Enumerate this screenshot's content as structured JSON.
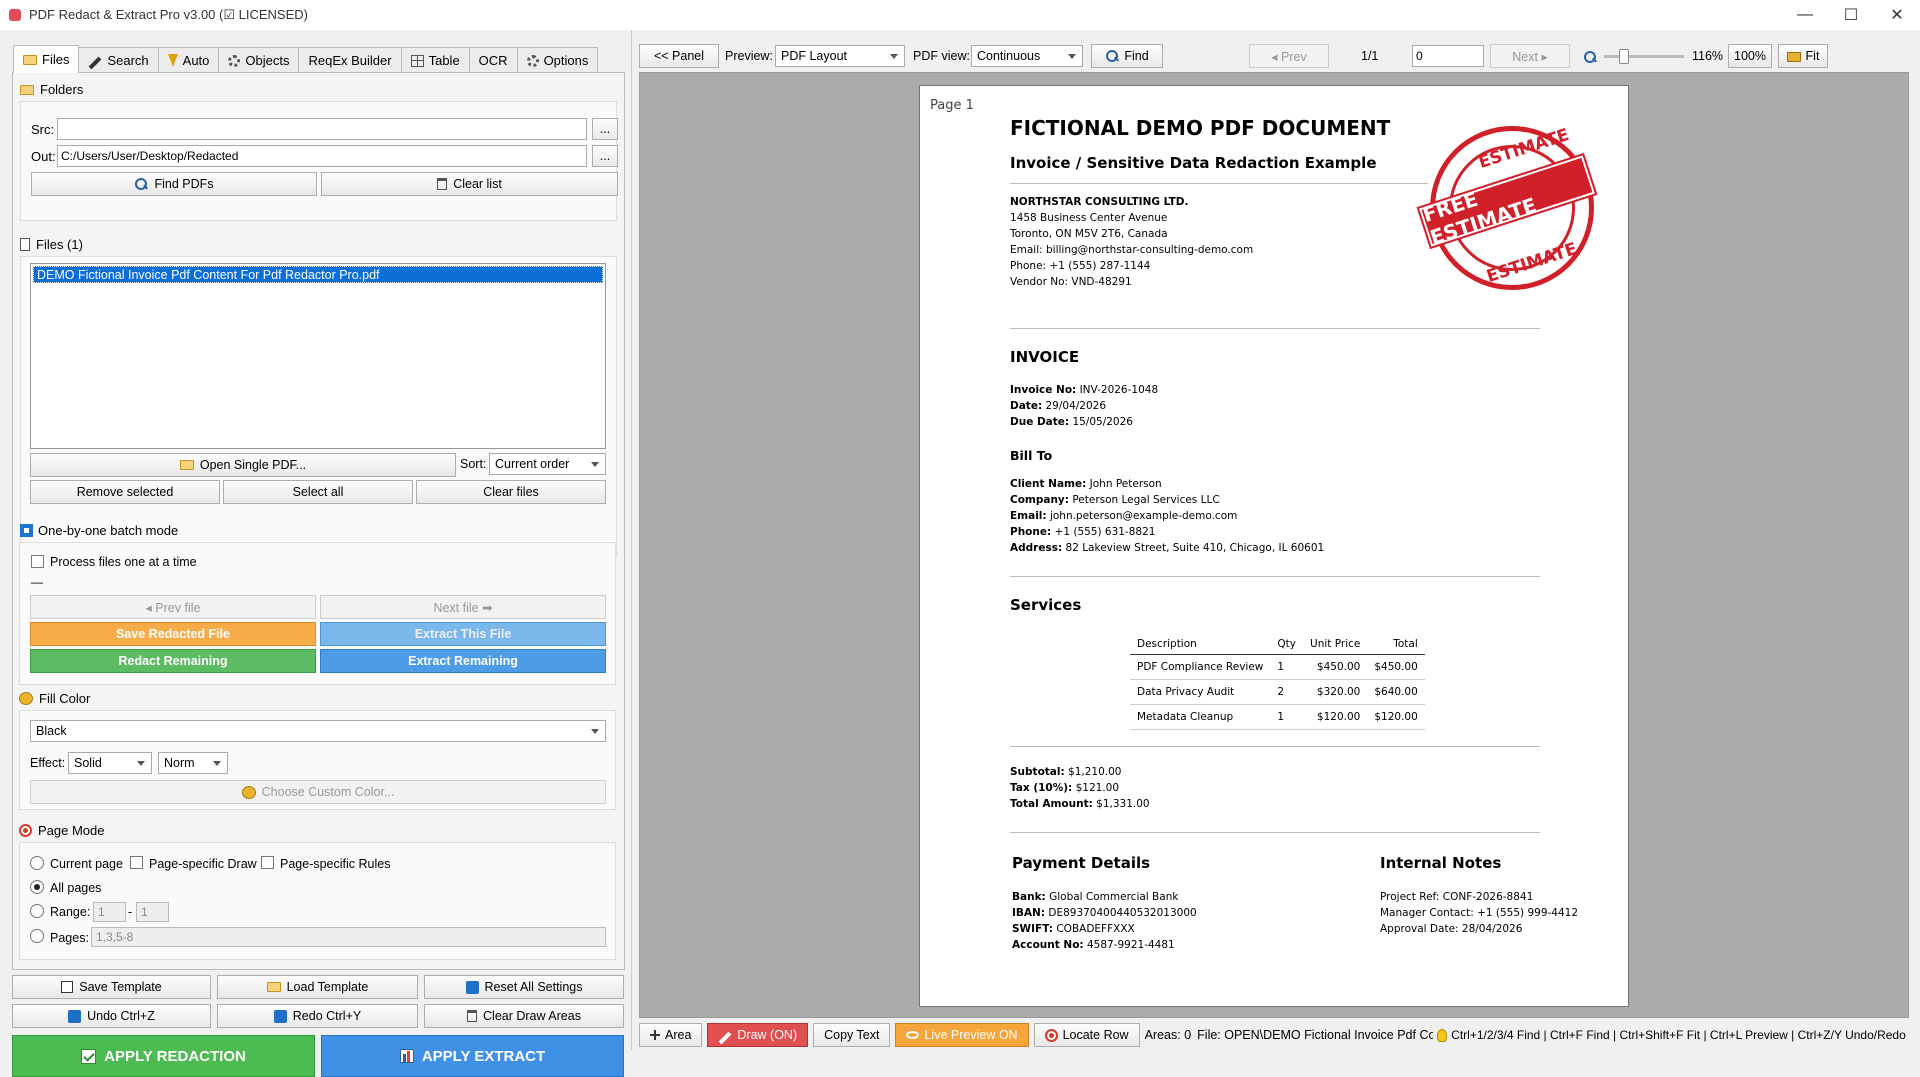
{
  "window": {
    "title": "PDF Redact & Extract Pro v3.00 (☑ LICENSED)",
    "controls": [
      "—",
      "☐",
      "✕"
    ]
  },
  "tabs": [
    {
      "label": "Files",
      "icon": "folder-icon",
      "active": true
    },
    {
      "label": "Search",
      "icon": "pencil-icon"
    },
    {
      "label": "Auto",
      "icon": "bolt-icon"
    },
    {
      "label": "Objects",
      "icon": "gear-icon"
    },
    {
      "label": "ReqEx Builder",
      "icon": ""
    },
    {
      "label": "Table",
      "icon": "table-icon"
    },
    {
      "label": "OCR",
      "icon": ""
    },
    {
      "label": "Options",
      "icon": "gear-icon"
    }
  ],
  "folders": {
    "title": "Folders",
    "src_label": "Src:",
    "src_value": "",
    "out_label": "Out:",
    "out_value": "C:/Users/User/Desktop/Redacted",
    "browse": "...",
    "find_pdfs": "Find PDFs",
    "clear_list": "Clear list"
  },
  "files": {
    "title": "Files (1)",
    "items": [
      "DEMO Fictional Invoice Pdf Content For Pdf Redactor Pro.pdf"
    ],
    "open_single": "Open Single PDF...",
    "sort_label": "Sort:",
    "sort_value": "Current order",
    "remove_selected": "Remove selected",
    "select_all": "Select all",
    "clear_files": "Clear files"
  },
  "batch": {
    "title": "One-by-one batch mode",
    "process_one": "Process files one at a time",
    "status": "—",
    "prev_file": "◂ Prev file",
    "next_file": "Next file ➡",
    "save_redacted": "Save Redacted File",
    "extract_this": "Extract This File",
    "redact_remaining": "Redact Remaining",
    "extract_remaining": "Extract Remaining"
  },
  "fill": {
    "title": "Fill Color",
    "color_value": "Black",
    "effect_label": "Effect:",
    "effect_value": "Solid",
    "norm_value": "Norm",
    "custom_color": "Choose Custom Color..."
  },
  "page_mode": {
    "title": "Page Mode",
    "current_page": "Current page",
    "page_specific_draw": "Page-specific Draw",
    "page_specific_rules": "Page-specific Rules",
    "all_pages": "All pages",
    "range_label": "Range:",
    "range_from": "1",
    "range_dash": "-",
    "range_to": "1",
    "pages_label": "Pages:",
    "pages_placeholder": "1,3,5-8"
  },
  "bottom": {
    "save_template": "Save Template",
    "load_template": "Load Template",
    "reset_all": "Reset All Settings",
    "undo": "Undo  Ctrl+Z",
    "redo": "Redo  Ctrl+Y",
    "clear_draw": "Clear Draw Areas",
    "apply_redaction": "APPLY REDACTION",
    "apply_extract": "APPLY EXTRACT"
  },
  "viewer_toolbar": {
    "panel": "<< Panel",
    "preview_label": "Preview:",
    "preview_value": "PDF Layout",
    "pdfview_label": "PDF view:",
    "pdfview_value": "Continuous",
    "find": "Find",
    "prev": "◂ Prev",
    "page_count": "1/1",
    "page_input": "0",
    "next": "Next ▸",
    "zoom": "116%",
    "zoom_100": "100%",
    "fit": "Fit"
  },
  "document": {
    "page_label": "Page 1",
    "title": "FICTIONAL DEMO PDF DOCUMENT",
    "subtitle": "Invoice / Sensitive Data Redaction Example",
    "stamp_top": "ESTIMATE",
    "stamp_band": "FREE ESTIMATE",
    "stamp_bottom": "ESTIMATE",
    "company": "NORTHSTAR CONSULTING LTD.",
    "address1": "1458 Business Center Avenue",
    "address2": "Toronto, ON M5V 2T6, Canada",
    "email": "Email: billing@northstar-consulting-demo.com",
    "phone": "Phone: +1 (555) 287-1144",
    "vendor": "Vendor No: VND-48291",
    "invoice_heading": "INVOICE",
    "invoice_no_k": "Invoice No:",
    "invoice_no_v": " INV-2026-1048",
    "date_k": "Date:",
    "date_v": " 29/04/2026",
    "due_k": "Due Date:",
    "due_v": " 15/05/2026",
    "bill_to": "Bill To",
    "client_k": "Client Name:",
    "client_v": " John Peterson",
    "company_k": "Company:",
    "company_v": " Peterson Legal Services LLC",
    "cemail_k": "Email:",
    "cemail_v": " john.peterson@example-demo.com",
    "cphone_k": "Phone:",
    "cphone_v": " +1 (555) 631-8821",
    "caddr_k": "Address:",
    "caddr_v": " 82 Lakeview Street, Suite 410, Chicago, IL 60601",
    "services_heading": "Services",
    "services_columns": [
      "Description",
      "Qty",
      "Unit Price",
      "Total"
    ],
    "services_rows": [
      [
        "PDF Compliance Review",
        "1",
        "$450.00",
        "$450.00"
      ],
      [
        "Data Privacy Audit",
        "2",
        "$320.00",
        "$640.00"
      ],
      [
        "Metadata Cleanup",
        "1",
        "$120.00",
        "$120.00"
      ]
    ],
    "subtotal_k": "Subtotal:",
    "subtotal_v": " $1,210.00",
    "tax_k": "Tax (10%):",
    "tax_v": " $121.00",
    "total_k": "Total Amount:",
    "total_v": " $1,331.00",
    "payment_heading": "Payment Details",
    "bank_k": "Bank:",
    "bank_v": " Global Commercial Bank",
    "iban_k": "IBAN:",
    "iban_v": " DE89370400440532013000",
    "swift_k": "SWIFT:",
    "swift_v": " COBADEFFXXX",
    "acct_k": "Account No:",
    "acct_v": " 4587-9921-4481",
    "notes_heading": "Internal Notes",
    "project_ref": "Project Ref: CONF-2026-8841",
    "manager": "Manager Contact: +1 (555) 999-4412",
    "approval": "Approval Date: 28/04/2026"
  },
  "statusbar": {
    "area": "Area",
    "draw": "Draw (ON)",
    "copy_text": "Copy Text",
    "live_preview": "Live Preview ON",
    "locate_row": "Locate Row",
    "areas": "Areas: 0",
    "file": "File: OPEN\\DEMO Fictional Invoice Pdf Content F",
    "shortcuts": "Ctrl+1/2/3/4 Find | Ctrl+F Find | Ctrl+Shift+F Fit | Ctrl+L Preview | Ctrl+Z/Y Undo/Redo"
  }
}
